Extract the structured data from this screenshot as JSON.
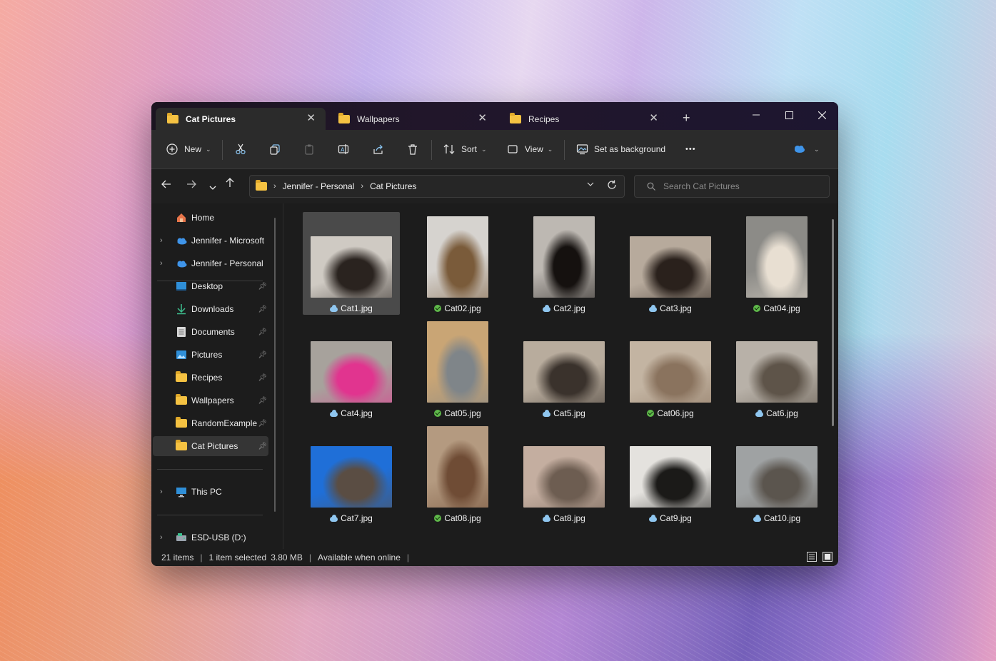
{
  "tabs": [
    {
      "label": "Cat Pictures",
      "active": true
    },
    {
      "label": "Wallpapers",
      "active": false
    },
    {
      "label": "Recipes",
      "active": false
    }
  ],
  "window_controls": {
    "new_tab": "+",
    "minimize": "—",
    "maximize": "☐",
    "close": "✕"
  },
  "toolbar": {
    "new_label": "New",
    "sort_label": "Sort",
    "view_label": "View",
    "set_bg_label": "Set as background",
    "more_label": "•••"
  },
  "address": {
    "segments": [
      "Jennifer - Personal",
      "Cat Pictures"
    ],
    "search_placeholder": "Search Cat Pictures"
  },
  "sidebar": {
    "items": [
      {
        "label": "Home",
        "icon": "home-icon"
      },
      {
        "label": "Jennifer - Microsoft",
        "icon": "onedrive-icon"
      },
      {
        "label": "Jennifer - Personal",
        "icon": "onedrive-icon"
      },
      {
        "label": "Desktop",
        "icon": "desktop-icon"
      },
      {
        "label": "Downloads",
        "icon": "download-icon"
      },
      {
        "label": "Documents",
        "icon": "document-icon"
      },
      {
        "label": "Pictures",
        "icon": "pictures-icon"
      },
      {
        "label": "Recipes",
        "icon": "folder-icon"
      },
      {
        "label": "Wallpapers",
        "icon": "folder-icon"
      },
      {
        "label": "RandomExample",
        "icon": "folder-icon"
      },
      {
        "label": "Cat Pictures",
        "icon": "folder-icon",
        "selected": true
      },
      {
        "label": "This PC",
        "icon": "pc-icon"
      },
      {
        "label": "ESD-USB (D:)",
        "icon": "usb-drive-icon"
      }
    ]
  },
  "files": [
    {
      "name": "Cat1.jpg",
      "status": "online-only",
      "selected": true,
      "colors": [
        "#cfcac3",
        "#2a231f"
      ]
    },
    {
      "name": "Cat02.jpg",
      "status": "synced",
      "colors": [
        "#d6d3cf",
        "#7a5b3a"
      ]
    },
    {
      "name": "Cat2.jpg",
      "status": "online-only",
      "colors": [
        "#bdb8b2",
        "#15110f"
      ]
    },
    {
      "name": "Cat3.jpg",
      "status": "online-only",
      "colors": [
        "#b7aa9c",
        "#2a211c"
      ]
    },
    {
      "name": "Cat04.jpg",
      "status": "synced",
      "colors": [
        "#8c8b87",
        "#e8dfd2"
      ]
    },
    {
      "name": "Cat4.jpg",
      "status": "online-only",
      "colors": [
        "#a7a29c",
        "#e1348f"
      ]
    },
    {
      "name": "Cat05.jpg",
      "status": "synced",
      "colors": [
        "#c9a575",
        "#7f8589"
      ]
    },
    {
      "name": "Cat5.jpg",
      "status": "online-only",
      "colors": [
        "#b8ac9d",
        "#3a322c"
      ]
    },
    {
      "name": "Cat06.jpg",
      "status": "synced",
      "colors": [
        "#c3b4a2",
        "#8a735e"
      ]
    },
    {
      "name": "Cat6.jpg",
      "status": "online-only",
      "colors": [
        "#b8b1a8",
        "#5e5449"
      ]
    },
    {
      "name": "Cat7.jpg",
      "status": "online-only",
      "colors": [
        "#1f6fd8",
        "#5a4d43"
      ]
    },
    {
      "name": "Cat08.jpg",
      "status": "synced",
      "colors": [
        "#b49a80",
        "#6f4c35"
      ]
    },
    {
      "name": "Cat8.jpg",
      "status": "online-only",
      "colors": [
        "#c4aea0",
        "#6d5d51"
      ]
    },
    {
      "name": "Cat9.jpg",
      "status": "online-only",
      "colors": [
        "#e4e2de",
        "#1b1a18"
      ]
    },
    {
      "name": "Cat10.jpg",
      "status": "online-only",
      "colors": [
        "#9fa2a3",
        "#5b554e"
      ]
    },
    {
      "name": "",
      "status": "",
      "colors": [
        "#a8a39d",
        "#4c4640"
      ]
    },
    {
      "name": "",
      "status": "",
      "colors": [
        "#c7bdb5",
        "#4a413b"
      ]
    },
    {
      "name": "",
      "status": "",
      "colors": [
        "#3a2c22",
        "#c9a34b"
      ]
    },
    {
      "name": "",
      "status": "",
      "colors": [
        "#8f97a3",
        "#3c3e42"
      ]
    },
    {
      "name": "",
      "status": "",
      "colors": [
        "#a99f96",
        "#4c463f"
      ]
    }
  ],
  "status": {
    "count": "21 items",
    "selection": "1 item selected",
    "size": "3.80 MB",
    "availability": "Available when online"
  }
}
